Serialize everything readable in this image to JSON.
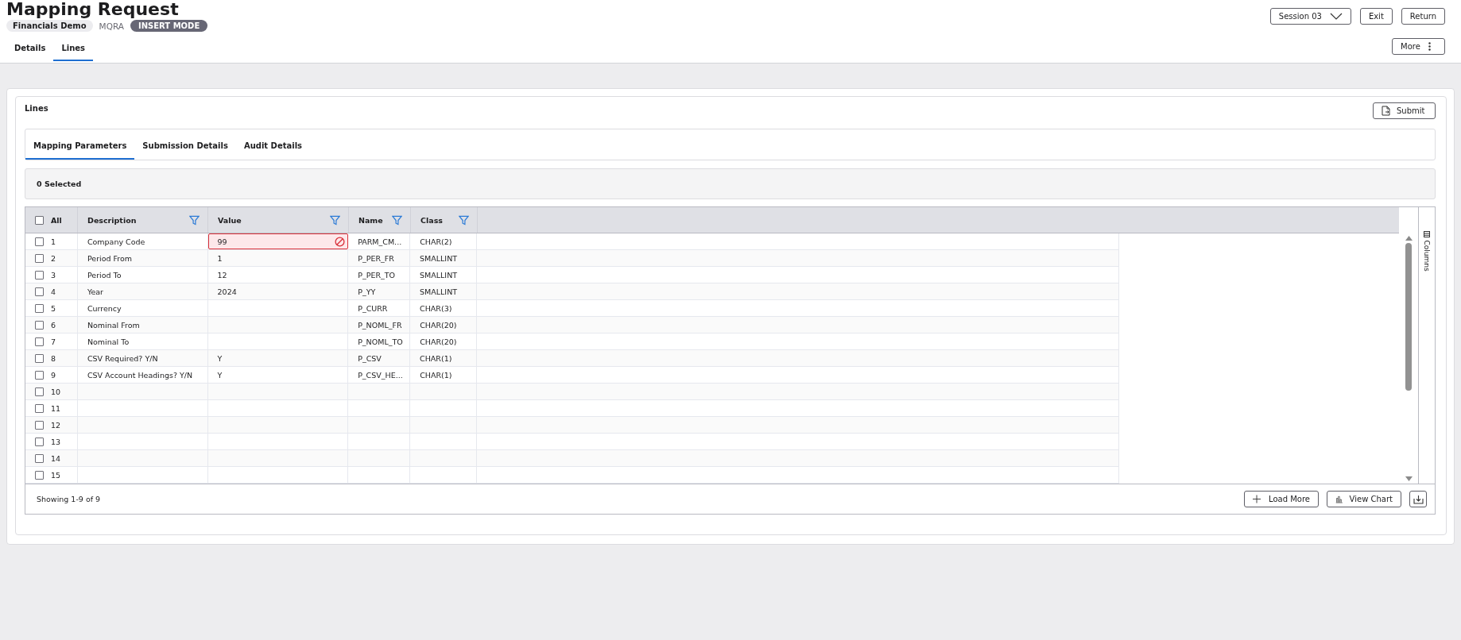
{
  "header": {
    "title": "Mapping Request",
    "company": "Financials Demo",
    "code": "MQRA",
    "mode": "INSERT MODE"
  },
  "header_actions": {
    "session": "Session 03",
    "buttons": [
      "Exit",
      "Return"
    ],
    "more": "More"
  },
  "tabs": [
    {
      "label": "Details",
      "selected": false
    },
    {
      "label": "Lines",
      "selected": true
    }
  ],
  "panel": {
    "title": "Lines",
    "submit": "Submit"
  },
  "sub_tabs": [
    {
      "label": "Mapping Parameters",
      "selected": true
    },
    {
      "label": "Submission Details",
      "selected": false
    },
    {
      "label": "Audit Details",
      "selected": false
    }
  ],
  "selection": {
    "text": "0 Selected"
  },
  "table": {
    "all_label": "All",
    "all_checked": false,
    "columns": [
      {
        "label": "Description"
      },
      {
        "label": "Value"
      },
      {
        "label": "Name"
      },
      {
        "label": "Class"
      }
    ],
    "rows": [
      {
        "number": "1",
        "checked": false,
        "error": true,
        "cells": [
          "Company Code",
          "99",
          "PARM_CM...",
          "CHAR(2)"
        ]
      },
      {
        "number": "2",
        "checked": false,
        "error": false,
        "cells": [
          "Period From",
          "1",
          "P_PER_FR",
          "SMALLINT"
        ]
      },
      {
        "number": "3",
        "checked": false,
        "error": false,
        "cells": [
          "Period To",
          "12",
          "P_PER_TO",
          "SMALLINT"
        ]
      },
      {
        "number": "4",
        "checked": false,
        "error": false,
        "cells": [
          "Year",
          "2024",
          "P_YY",
          "SMALLINT"
        ]
      },
      {
        "number": "5",
        "checked": false,
        "error": false,
        "cells": [
          "Currency",
          "",
          "P_CURR",
          "CHAR(3)"
        ]
      },
      {
        "number": "6",
        "checked": false,
        "error": false,
        "cells": [
          "Nominal From",
          "",
          "P_NOML_FR",
          "CHAR(20)"
        ]
      },
      {
        "number": "7",
        "checked": false,
        "error": false,
        "cells": [
          "Nominal To",
          "",
          "P_NOML_TO",
          "CHAR(20)"
        ]
      },
      {
        "number": "8",
        "checked": false,
        "error": false,
        "cells": [
          "CSV Required? Y/N",
          "Y",
          "P_CSV",
          "CHAR(1)"
        ]
      },
      {
        "number": "9",
        "checked": false,
        "error": false,
        "cells": [
          "CSV Account Headings? Y/N",
          "Y",
          "P_CSV_HE...",
          "CHAR(1)"
        ]
      },
      {
        "number": "10",
        "checked": false,
        "error": false,
        "cells": [
          "",
          "",
          "",
          ""
        ]
      },
      {
        "number": "11",
        "checked": false,
        "error": false,
        "cells": [
          "",
          "",
          "",
          ""
        ]
      },
      {
        "number": "12",
        "checked": false,
        "error": false,
        "cells": [
          "",
          "",
          "",
          ""
        ]
      },
      {
        "number": "13",
        "checked": false,
        "error": false,
        "cells": [
          "",
          "",
          "",
          ""
        ]
      },
      {
        "number": "14",
        "checked": false,
        "error": false,
        "cells": [
          "",
          "",
          "",
          ""
        ]
      },
      {
        "number": "15",
        "checked": false,
        "error": false,
        "cells": [
          "",
          "",
          "",
          ""
        ]
      }
    ],
    "side_panel": "Columns",
    "footer": {
      "showing": "Showing 1-9 of 9",
      "load_more": "Load More",
      "view_chart": "View Chart"
    }
  }
}
